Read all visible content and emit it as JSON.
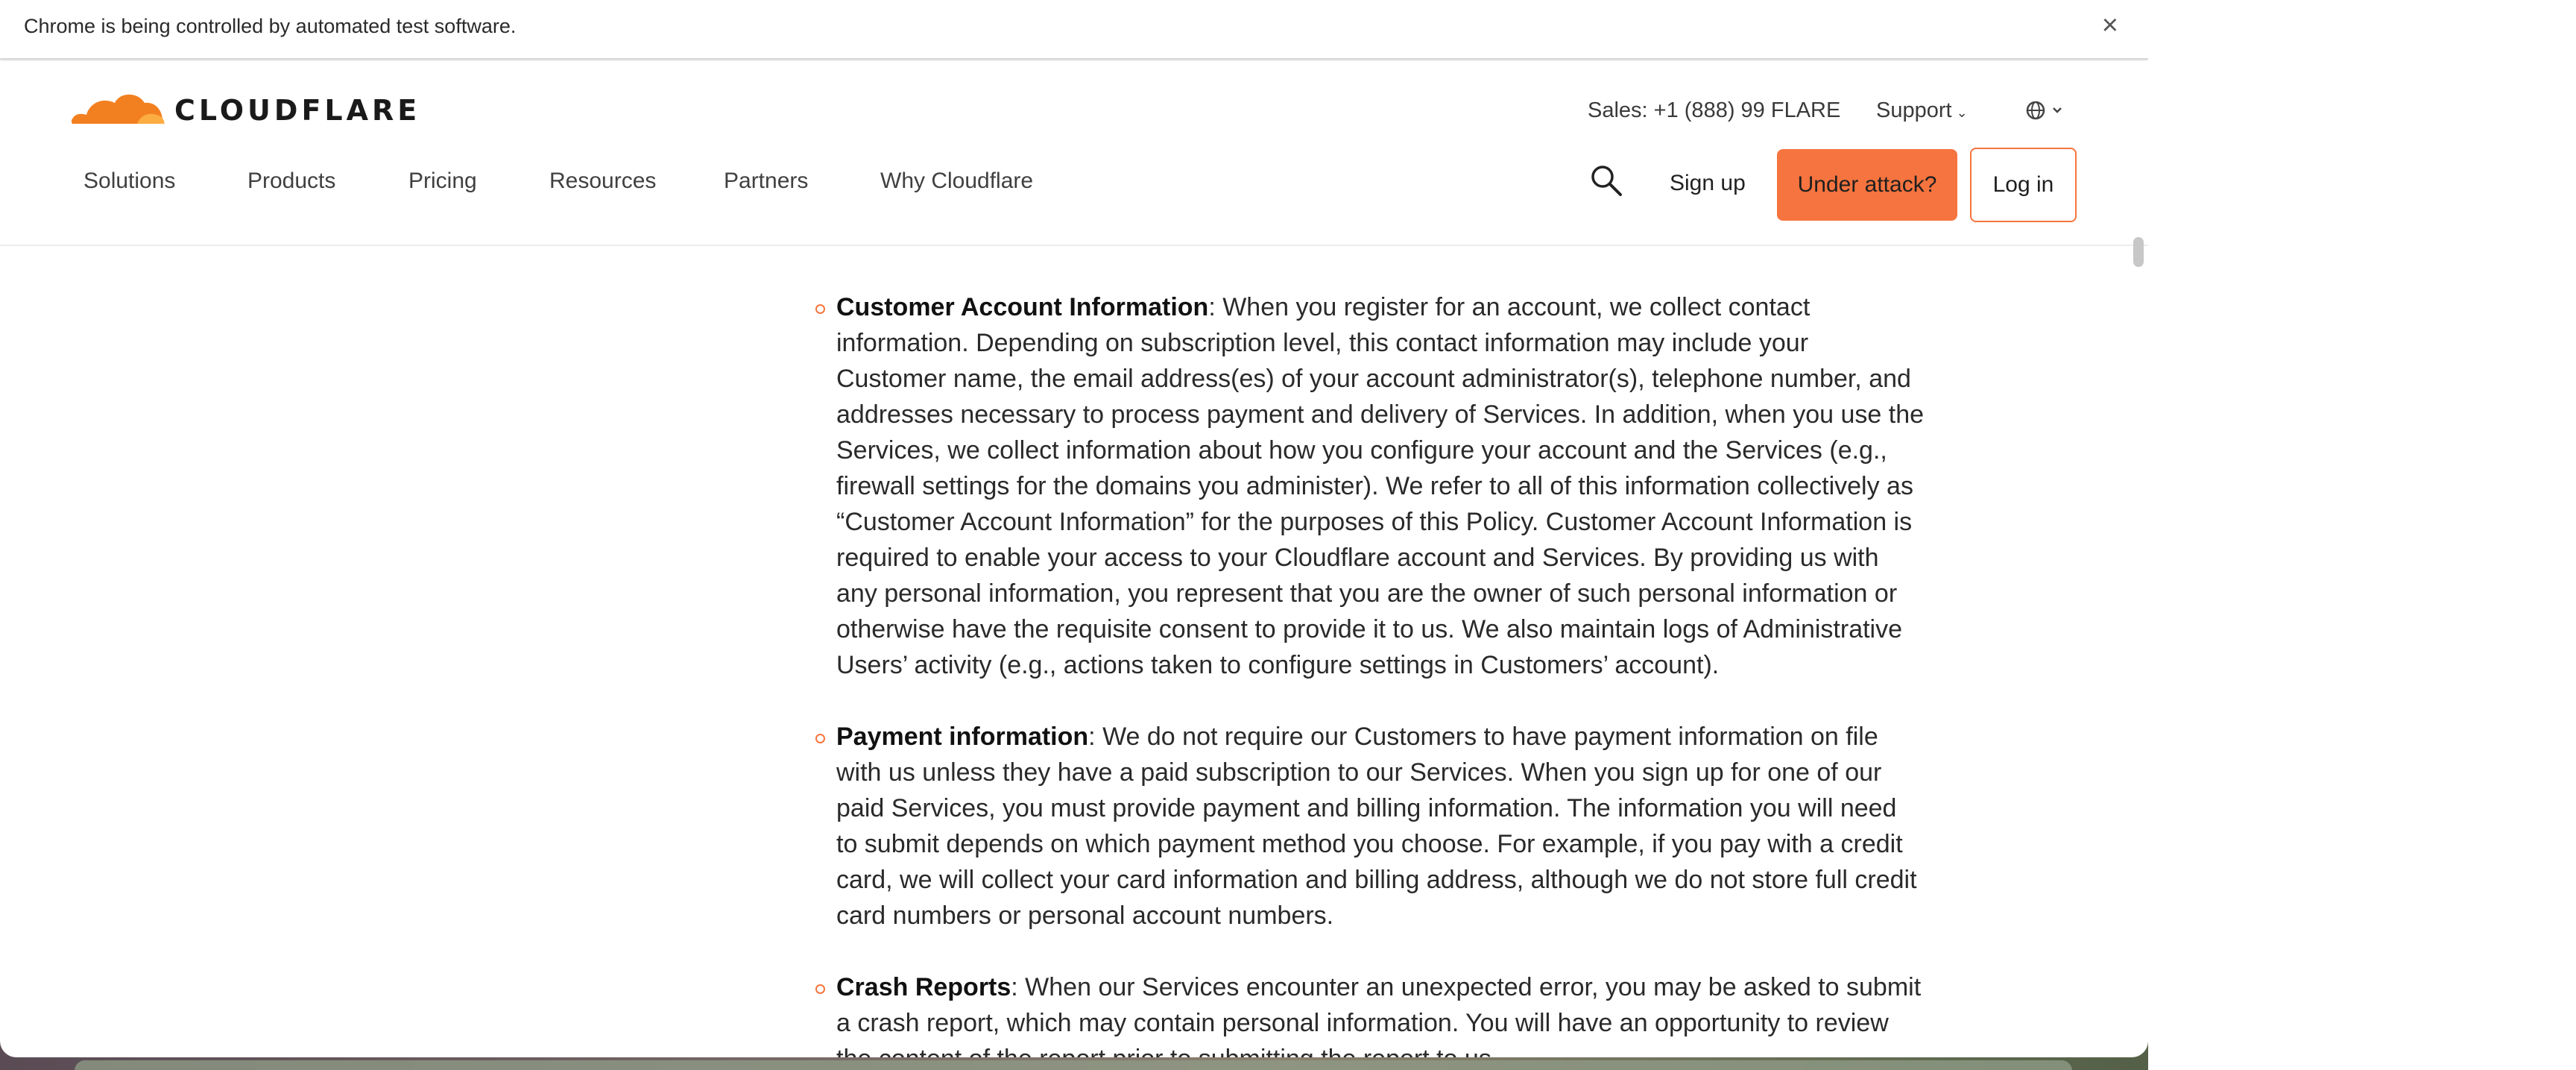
{
  "browser": {
    "automation_notice": "Chrome is being controlled by automated test software.",
    "close_label": "×"
  },
  "header": {
    "logo_text": "CLOUDFLARE",
    "sales": "Sales: +1 (888) 99 FLARE",
    "support": "Support",
    "nav": [
      "Solutions",
      "Products",
      "Pricing",
      "Resources",
      "Partners",
      "Why Cloudflare"
    ],
    "sign_up": "Sign up",
    "under_attack": "Under attack?",
    "log_in": "Log in",
    "colors": {
      "accent": "#f6743f",
      "logo_orange": "#f38020"
    }
  },
  "policy": {
    "items": [
      {
        "term": "Customer Account Information",
        "text": ": When you register for an account, we collect contact information. Depending on subscription level, this contact information may include your Customer name, the email address(es) of your account administrator(s), telephone number, and addresses necessary to process payment and delivery of Services. In addition, when you use the Services, we collect information about how you configure your account and the Services (e.g., firewall settings for the domains you administer). We refer to all of this information collectively as “Customer Account Information” for the purposes of this Policy. Customer Account Information is required to enable your access to your Cloudflare account and Services. By providing us with any personal information, you represent that you are the owner of such personal information or otherwise have the requisite consent to provide it to us. We also maintain logs of Administrative Users’ activity (e.g., actions taken to configure settings in Customers’ account)."
      },
      {
        "term": "Payment information",
        "text": ": We do not require our Customers to have payment information on file with us unless they have a paid subscription to our Services. When you sign up for one of our paid Services, you must provide payment and billing information. The information you will need to submit depends on which payment method you choose. For example, if you pay with a credit card, we will collect your card information and billing address, although we do not store full credit card numbers or personal account numbers."
      },
      {
        "term": "Crash Reports",
        "text": ": When our Services encounter an unexpected error, you may be asked to submit a crash report, which may contain personal information. You will have an opportunity to review the content of the report prior to submitting the report to us."
      }
    ]
  }
}
